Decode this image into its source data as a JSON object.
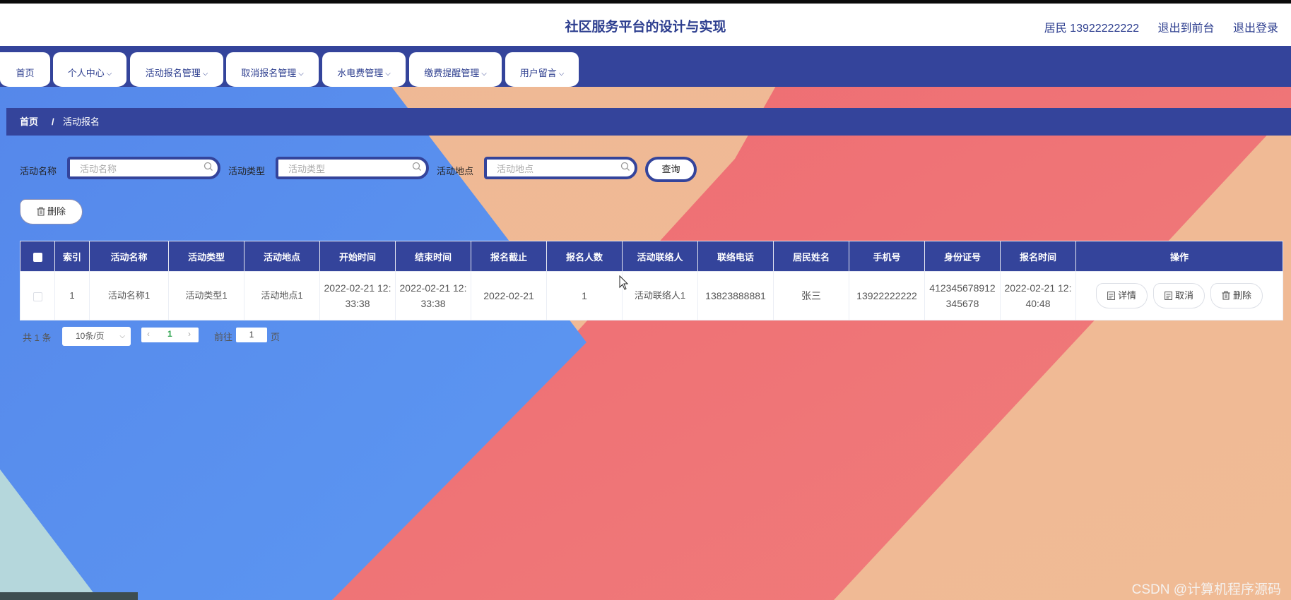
{
  "header": {
    "title": "社区服务平台的设计与实现",
    "user": "居民 13922222222",
    "to_front": "退出到前台",
    "logout": "退出登录"
  },
  "nav": [
    {
      "label": "首页",
      "dropdown": false
    },
    {
      "label": "个人中心",
      "dropdown": true
    },
    {
      "label": "活动报名管理",
      "dropdown": true
    },
    {
      "label": "取消报名管理",
      "dropdown": true
    },
    {
      "label": "水电费管理",
      "dropdown": true
    },
    {
      "label": "缴费提醒管理",
      "dropdown": true
    },
    {
      "label": "用户留言",
      "dropdown": true
    }
  ],
  "breadcrumb": {
    "home": "首页",
    "separator": "/",
    "current": "活动报名"
  },
  "search": {
    "name_label": "活动名称",
    "name_placeholder": "活动名称",
    "type_label": "活动类型",
    "type_placeholder": "活动类型",
    "place_label": "活动地点",
    "place_placeholder": "活动地点",
    "query": "查询"
  },
  "toolbar": {
    "delete": "删除"
  },
  "table": {
    "columns": [
      "索引",
      "活动名称",
      "活动类型",
      "活动地点",
      "开始时间",
      "结束时间",
      "报名截止",
      "报名人数",
      "活动联络人",
      "联络电话",
      "居民姓名",
      "手机号",
      "身份证号",
      "报名时间",
      "操作"
    ],
    "rows": [
      {
        "index": "1",
        "name": "活动名称1",
        "type": "活动类型1",
        "place": "活动地点1",
        "start": "2022-02-21 12:33:38",
        "end": "2022-02-21 12:33:38",
        "deadline": "2022-02-21",
        "count": "1",
        "contact": "活动联络人1",
        "contact_phone": "13823888881",
        "resident": "张三",
        "mobile": "13922222222",
        "id_card": "412345678912345678",
        "signup_time": "2022-02-21 12:40:48",
        "ops": {
          "detail": "详情",
          "cancel": "取消",
          "delete": "删除"
        }
      }
    ]
  },
  "pagination": {
    "total": "共 1 条",
    "page_size": "10条/页",
    "current": "1",
    "goto_prefix": "前往",
    "goto_value": "1",
    "goto_suffix": "页"
  },
  "watermark": "CSDN @计算机程序源码",
  "colors": {
    "primary": "#34449b",
    "bg_blue": "#5b93ee",
    "bg_peach": "#eeb08f",
    "bg_red": "#ef6f72"
  }
}
